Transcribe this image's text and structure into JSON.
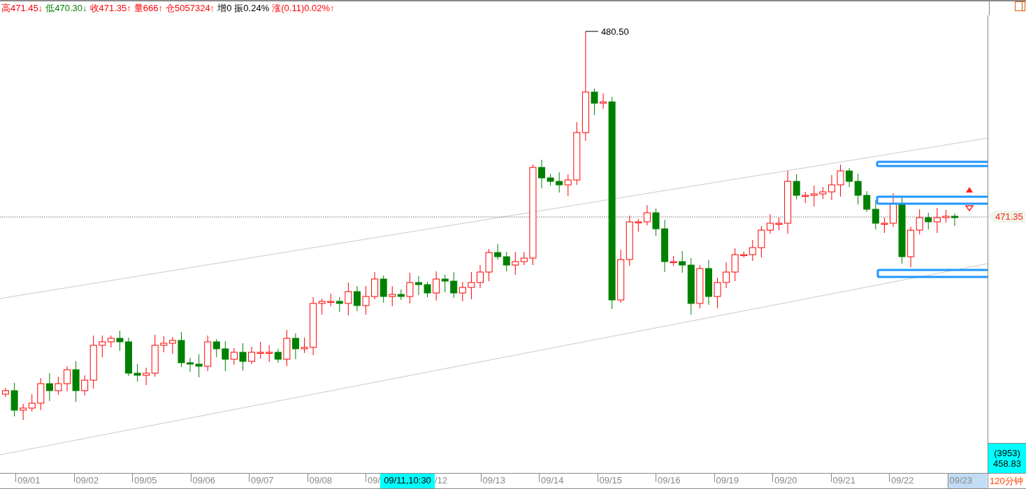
{
  "quote_bar": {
    "items": [
      {
        "text": "高471.45↓",
        "color": "#ff0000"
      },
      {
        "text": "低470.30↓",
        "color": "#008000"
      },
      {
        "text": "收471.35↑",
        "color": "#ff0000"
      },
      {
        "text": "量666↑",
        "color": "#ff0000"
      },
      {
        "text": "仓5057324↑",
        "color": "#ff0000"
      },
      {
        "text": "增0",
        "color": "#000000"
      },
      {
        "text": "振0.24%",
        "color": "#000000"
      },
      {
        "text": "涨(0.11)0.02%↑",
        "color": "#ff0000"
      }
    ]
  },
  "chart": {
    "peak_label": "480.50",
    "last_price": "471.35",
    "cursor_box": {
      "count": "(3953)",
      "price": "458.83"
    }
  },
  "time_axis": {
    "items": [
      {
        "text": "09/01",
        "kind": "date"
      },
      {
        "text": "09/02",
        "kind": "date"
      },
      {
        "text": "09/05",
        "kind": "date"
      },
      {
        "text": "09/06",
        "kind": "date"
      },
      {
        "text": "09/07",
        "kind": "date"
      },
      {
        "text": "09/08",
        "kind": "date"
      },
      {
        "text": "09/",
        "kind": "cut"
      },
      {
        "text": "09/11,10:30",
        "kind": "cursor"
      },
      {
        "text": "/12",
        "kind": "tail"
      },
      {
        "text": "09/13",
        "kind": "date"
      },
      {
        "text": "09/14",
        "kind": "date"
      },
      {
        "text": "09/15",
        "kind": "date"
      },
      {
        "text": "09/16",
        "kind": "date"
      },
      {
        "text": "09/19",
        "kind": "date"
      },
      {
        "text": "09/20",
        "kind": "date"
      },
      {
        "text": "09/21",
        "kind": "date"
      },
      {
        "text": "09/22",
        "kind": "date"
      },
      {
        "text": "09/23",
        "kind": "last"
      }
    ],
    "period": "120分钟"
  }
}
